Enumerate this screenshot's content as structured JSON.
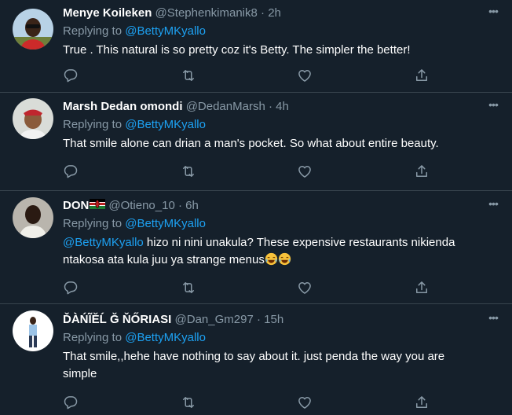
{
  "tweets": [
    {
      "name": "Menye Koileken",
      "handle": "@Stephenkimanik8",
      "dot": "·",
      "time": "2h",
      "replying_label": "Replying to",
      "replying_to": "@BettyMKyallo",
      "text": "True . This natural is so pretty coz it's Betty. The simpler the better!",
      "more": "•••"
    },
    {
      "name": "Marsh Dedan omondi",
      "handle": "@DedanMarsh",
      "dot": "·",
      "time": "4h",
      "replying_label": "Replying to",
      "replying_to": "@BettyMKyallo",
      "text": "That smile alone can drian a man's pocket. So what about entire beauty.",
      "more": "•••"
    },
    {
      "name": "DON",
      "flag": "kenya-flag-icon",
      "handle": "@Otieno_10",
      "dot": "·",
      "time": "6h",
      "replying_label": "Replying to",
      "replying_to": "@BettyMKyallo",
      "text_mention": "@BettyMKyallo",
      "text_line1": " hizo ni nini unakula? These expensive restaurants nikienda",
      "text_line2": "ntakosa ata kula juu ya strange menus",
      "emoji": "face-with-tears-of-joy-icon",
      "more": "•••"
    },
    {
      "name": "ĎÀŃĨĔĹ Ğ ŇŐRIASI",
      "handle": "@Dan_Gm297",
      "dot": "·",
      "time": "15h",
      "replying_label": "Replying to",
      "replying_to": "@BettyMKyallo",
      "text_line1": "That smile,,hehe have nothing to say about it. just penda the way you are",
      "text_line2": "simple",
      "more": "•••"
    }
  ],
  "colors": {
    "background": "#15202b",
    "divider": "#38444d",
    "secondary_text": "#8899a6",
    "link": "#1da1f2"
  },
  "icons": [
    "reply-icon",
    "retweet-icon",
    "like-icon",
    "share-icon",
    "more-icon"
  ]
}
